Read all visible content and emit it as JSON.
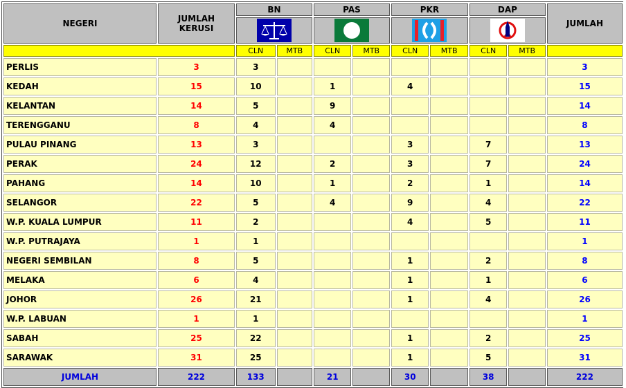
{
  "headers": {
    "state": "NEGERI",
    "seats_line1": "JUMLAH",
    "seats_line2": "KERUSI",
    "total": "JUMLAH",
    "cln": "CLN",
    "mtb": "MTB"
  },
  "parties": [
    {
      "name": "BN",
      "logo": "scales-icon",
      "bg": "#0000aa"
    },
    {
      "name": "PAS",
      "logo": "pas-moon-icon",
      "bg": "#0a7a3a"
    },
    {
      "name": "PKR",
      "logo": "pkr-eye-icon",
      "bg": "#1ea0e6"
    },
    {
      "name": "DAP",
      "logo": "rocket-icon",
      "bg": "#ffffff"
    }
  ],
  "colors": {
    "seats": "#ff0000",
    "total": "#0000ff",
    "row_bg": "#ffffc0",
    "header_bg": "#c0c0c0",
    "subheader_bg": "#ffff00"
  },
  "rows": [
    {
      "state": "PERLIS",
      "seats": "3",
      "bn": "3",
      "pas": "",
      "pkr": "",
      "dap": "",
      "total": "3"
    },
    {
      "state": "KEDAH",
      "seats": "15",
      "bn": "10",
      "pas": "1",
      "pkr": "4",
      "dap": "",
      "total": "15"
    },
    {
      "state": "KELANTAN",
      "seats": "14",
      "bn": "5",
      "pas": "9",
      "pkr": "",
      "dap": "",
      "total": "14"
    },
    {
      "state": "TERENGGANU",
      "seats": "8",
      "bn": "4",
      "pas": "4",
      "pkr": "",
      "dap": "",
      "total": "8"
    },
    {
      "state": "PULAU PINANG",
      "seats": "13",
      "bn": "3",
      "pas": "",
      "pkr": "3",
      "dap": "7",
      "total": "13"
    },
    {
      "state": "PERAK",
      "seats": "24",
      "bn": "12",
      "pas": "2",
      "pkr": "3",
      "dap": "7",
      "total": "24"
    },
    {
      "state": "PAHANG",
      "seats": "14",
      "bn": "10",
      "pas": "1",
      "pkr": "2",
      "dap": "1",
      "total": "14"
    },
    {
      "state": "SELANGOR",
      "seats": "22",
      "bn": "5",
      "pas": "4",
      "pkr": "9",
      "dap": "4",
      "total": "22"
    },
    {
      "state": "W.P. KUALA LUMPUR",
      "seats": "11",
      "bn": "2",
      "pas": "",
      "pkr": "4",
      "dap": "5",
      "total": "11"
    },
    {
      "state": "W.P. PUTRAJAYA",
      "seats": "1",
      "bn": "1",
      "pas": "",
      "pkr": "",
      "dap": "",
      "total": "1"
    },
    {
      "state": "NEGERI SEMBILAN",
      "seats": "8",
      "bn": "5",
      "pas": "",
      "pkr": "1",
      "dap": "2",
      "total": "8"
    },
    {
      "state": "MELAKA",
      "seats": "6",
      "bn": "4",
      "pas": "",
      "pkr": "1",
      "dap": "1",
      "total": "6"
    },
    {
      "state": "JOHOR",
      "seats": "26",
      "bn": "21",
      "pas": "",
      "pkr": "1",
      "dap": "4",
      "total": "26"
    },
    {
      "state": "W.P. LABUAN",
      "seats": "1",
      "bn": "1",
      "pas": "",
      "pkr": "",
      "dap": "",
      "total": "1"
    },
    {
      "state": "SABAH",
      "seats": "25",
      "bn": "22",
      "pas": "",
      "pkr": "1",
      "dap": "2",
      "total": "25"
    },
    {
      "state": "SARAWAK",
      "seats": "31",
      "bn": "25",
      "pas": "",
      "pkr": "1",
      "dap": "5",
      "total": "31"
    }
  ],
  "footer": {
    "label": "JUMLAH",
    "seats": "222",
    "bn": "133",
    "pas": "21",
    "pkr": "30",
    "dap": "38",
    "total": "222"
  }
}
